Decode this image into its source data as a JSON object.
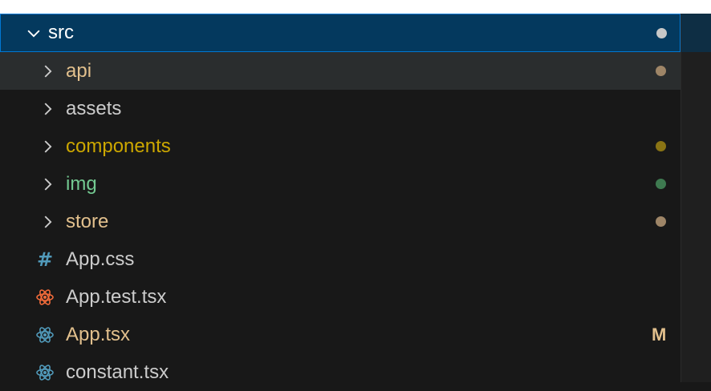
{
  "explorer": {
    "root": {
      "label": "src",
      "expanded": true,
      "status_color": "#c8c8c8"
    },
    "folders": [
      {
        "label": "api",
        "label_color": "#e2c08d",
        "status_color": "#9e8567"
      },
      {
        "label": "assets",
        "label_color": "#cccccc",
        "status_color": ""
      },
      {
        "label": "components",
        "label_color": "#cca700",
        "status_color": "#8a7414"
      },
      {
        "label": "img",
        "label_color": "#73c991",
        "status_color": "#3e7a50"
      },
      {
        "label": "store",
        "label_color": "#e2c08d",
        "status_color": "#9e8567"
      }
    ],
    "files": [
      {
        "label": "App.css",
        "icon": "css-hash-icon",
        "label_color": "#cccccc",
        "badge": ""
      },
      {
        "label": "App.test.tsx",
        "icon": "react-icon",
        "icon_color": "#f26b3a",
        "label_color": "#cccccc",
        "badge": ""
      },
      {
        "label": "App.tsx",
        "icon": "react-icon",
        "icon_color": "#519aba",
        "label_color": "#e2c08d",
        "badge": "M",
        "badge_color": "#e2c08d"
      },
      {
        "label": "constant.tsx",
        "icon": "react-icon",
        "icon_color": "#519aba",
        "label_color": "#cccccc",
        "badge": ""
      }
    ]
  }
}
